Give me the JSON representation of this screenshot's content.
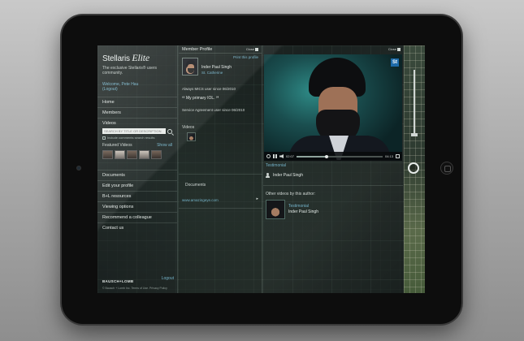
{
  "brand": {
    "name": "Stellaris",
    "tier": "Elite",
    "tagline": "The exclusive Stellaris® users community."
  },
  "welcome": {
    "text": "Welcome, Pete Hau",
    "logout": "(Logout)"
  },
  "nav": {
    "home": "Home",
    "members": "Members",
    "videos": "Videos"
  },
  "video_search": {
    "placeholder": "SEARCH BY TITLE OR DESCRIPTION",
    "checkbox_label": "Include comments search results",
    "featured_label": "Featured Videos",
    "show_all": "Show all"
  },
  "nav_secondary": [
    "Documents",
    "Edit your profile",
    "B+L resources",
    "Viewing options",
    "Recommend a colleague",
    "Contact us"
  ],
  "footer": {
    "logo": "BAUSCH+LOMB",
    "logout": "Logout",
    "legal": "© Bausch + Lomb Inc. Terms of Use. Privacy Policy"
  },
  "profile": {
    "title": "Member Profile",
    "close_label": "Close",
    "print_link": "Print this profile",
    "name": "Inder Paul Singh",
    "location": "St. Catherine",
    "mics_since": "Always MICS user since 06/2010",
    "quote": "My primary IOL.",
    "agreement_since": "Service Agreement user since 06/2010",
    "videos_label": "Videos",
    "documents_label": "Documents",
    "document_link": "www.amazingeye.com"
  },
  "player": {
    "close_label": "Close",
    "badge": "St",
    "current_time": "02:07",
    "total_time": "04:13",
    "progress": 0.35,
    "testimonial_label": "Testimonial",
    "author": "Inder Paul Singh",
    "other_label": "Other videos by this author:",
    "other_videos": [
      {
        "title": "Testimonial",
        "author": "Inder Paul Singh"
      }
    ]
  },
  "colors": {
    "accent": "#74b3c9",
    "panel_bg": "#1e2624"
  }
}
